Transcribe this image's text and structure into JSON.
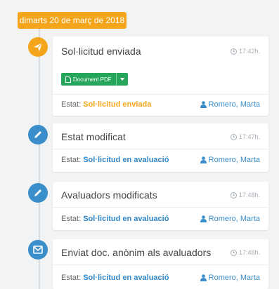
{
  "date_label": "dimarts 20 de març de 2018",
  "status_prefix": "Estat:",
  "entries": [
    {
      "title": "Sol·licitud enviada",
      "time": "17:42h.",
      "status": "Sol·licitud enviada",
      "author": "Romero, Marta",
      "icon": "paper-plane-icon",
      "document_button": "Document PDF"
    },
    {
      "title": "Estat modificat",
      "time": "17:47h.",
      "status": "Sol·licitud en avaluació",
      "author": "Romero, Marta",
      "icon": "pencil-icon"
    },
    {
      "title": "Avaluadors modificats",
      "time": "17:48h.",
      "status": "Sol·licitud en avaluació",
      "author": "Romero, Marta",
      "icon": "pencil-icon"
    },
    {
      "title": "Enviat doc. anònim als avaluadors",
      "time": "17:48h.",
      "status": "Sol·licitud en avaluació",
      "author": "Romero, Marta",
      "icon": "envelope-icon"
    }
  ],
  "colors": {
    "accent_orange": "#f4a51c",
    "accent_blue": "#3a8ec9",
    "button_green": "#26a65b"
  }
}
